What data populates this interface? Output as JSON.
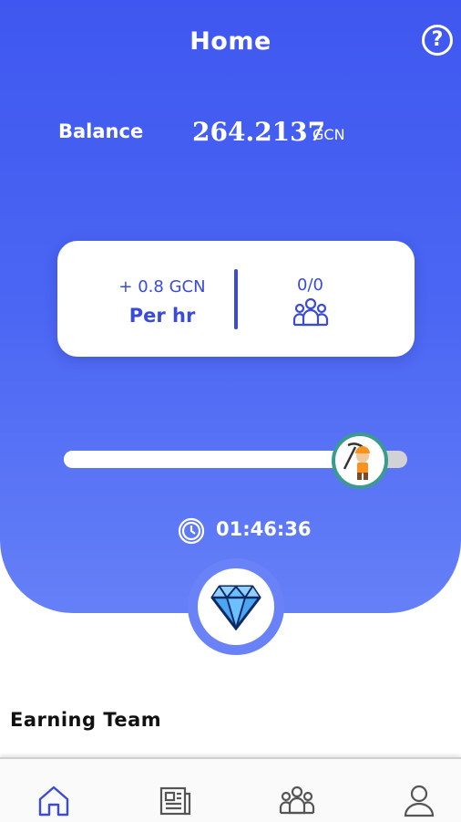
{
  "header": {
    "title": "Home",
    "help_icon": "question-circle-icon",
    "help_glyph": "?"
  },
  "balance": {
    "label": "Balance",
    "value": "264.2137",
    "unit": "GCN"
  },
  "rate_card": {
    "rate": "+ 0.8 GCN",
    "period": "Per hr",
    "team_count": "0/0",
    "team_icon": "team-icon"
  },
  "mining": {
    "progress_fraction": 0.88,
    "knob_icon": "miner-icon",
    "timer_icon": "clock-icon",
    "timer": "01:46:36"
  },
  "gem": {
    "icon": "diamond-icon"
  },
  "earning_team": {
    "title": "Earning Team"
  },
  "bottom_nav": {
    "items": [
      {
        "name": "home",
        "icon": "home-icon",
        "active": true
      },
      {
        "name": "news",
        "icon": "newspaper-icon",
        "active": false
      },
      {
        "name": "team",
        "icon": "team-icon",
        "active": false
      },
      {
        "name": "profile",
        "icon": "user-icon",
        "active": false
      }
    ]
  },
  "colors": {
    "hero_top": "#3f57f0",
    "hero_bottom": "#6580f7",
    "accent_text": "#3a4bd8",
    "knob_border": "#3b9c8e",
    "nav_active": "#3a4bd8",
    "nav_inactive": "#555555"
  }
}
